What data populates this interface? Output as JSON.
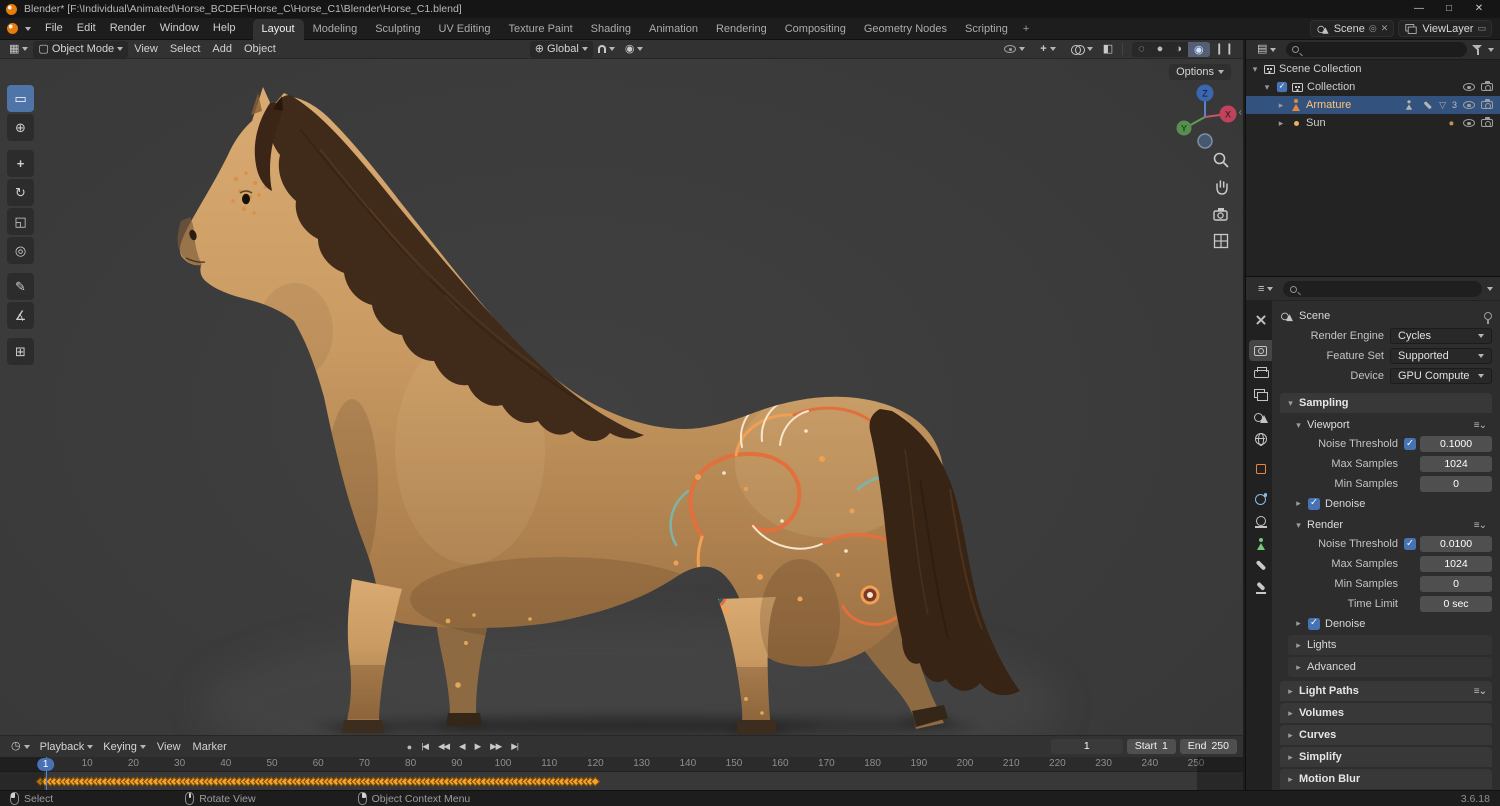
{
  "colors": {
    "accent": "#4772B3",
    "selection": "#33527E",
    "blender_orange": "#E8873B",
    "keyframe": "#F7A12B",
    "axis_x": "#C0435C",
    "axis_y": "#55904E",
    "axis_z": "#3B66B0"
  },
  "titlebar": {
    "title": "Blender* [F:\\Individual\\Animated\\Horse_BCDEF\\Horse_C\\Horse_C1\\Blender\\Horse_C1.blend]"
  },
  "topbar": {
    "menus": [
      "File",
      "Edit",
      "Render",
      "Window",
      "Help"
    ],
    "workspaces": [
      "Layout",
      "Modeling",
      "Sculpting",
      "UV Editing",
      "Texture Paint",
      "Shading",
      "Animation",
      "Rendering",
      "Compositing",
      "Geometry Nodes",
      "Scripting"
    ],
    "add_workspace": "+",
    "scene": "Scene",
    "view_layer": "ViewLayer"
  },
  "viewport": {
    "mode": "Object Mode",
    "menus": [
      "View",
      "Select",
      "Add",
      "Object"
    ],
    "orientation": "Global",
    "options": "Options",
    "axis": {
      "x": "X",
      "y": "Y",
      "z": "Z"
    }
  },
  "outliner": {
    "scene_collection": "Scene Collection",
    "collection": "Collection",
    "armature": "Armature",
    "armature_children_count": "3",
    "sun": "Sun"
  },
  "properties": {
    "breadcrumb": "Scene",
    "render_engine": {
      "label": "Render Engine",
      "value": "Cycles"
    },
    "feature_set": {
      "label": "Feature Set",
      "value": "Supported"
    },
    "device": {
      "label": "Device",
      "value": "GPU Compute"
    },
    "sampling_title": "Sampling",
    "viewport_panel": {
      "title": "Viewport",
      "noise_threshold": {
        "label": "Noise Threshold",
        "value": "0.1000"
      },
      "max_samples": {
        "label": "Max Samples",
        "value": "1024"
      },
      "min_samples": {
        "label": "Min Samples",
        "value": "0"
      },
      "denoise": "Denoise"
    },
    "render_panel": {
      "title": "Render",
      "noise_threshold": {
        "label": "Noise Threshold",
        "value": "0.0100"
      },
      "max_samples": {
        "label": "Max Samples",
        "value": "1024"
      },
      "min_samples": {
        "label": "Min Samples",
        "value": "0"
      },
      "time_limit": {
        "label": "Time Limit",
        "value": "0 sec"
      },
      "denoise": "Denoise"
    },
    "lights": "Lights",
    "advanced": "Advanced",
    "light_paths": "Light Paths",
    "volumes": "Volumes",
    "curves": "Curves",
    "simplify": "Simplify",
    "motion_blur": "Motion Blur"
  },
  "timeline": {
    "menus": [
      "Playback",
      "Keying",
      "View",
      "Marker"
    ],
    "current_frame": "1",
    "start": {
      "label": "Start",
      "value": "1"
    },
    "end": {
      "label": "End",
      "value": "250"
    },
    "frame_labels": [
      10,
      20,
      30,
      40,
      50,
      60,
      70,
      80,
      90,
      100,
      110,
      120,
      130,
      140,
      150,
      160,
      170,
      180,
      190,
      200,
      210,
      220,
      230,
      240,
      250
    ],
    "keyframes": {
      "from": 0,
      "to": 120
    }
  },
  "statusbar": {
    "select": "Select",
    "rotate_view": "Rotate View",
    "context_menu": "Object Context Menu",
    "version": "3.6.18"
  }
}
